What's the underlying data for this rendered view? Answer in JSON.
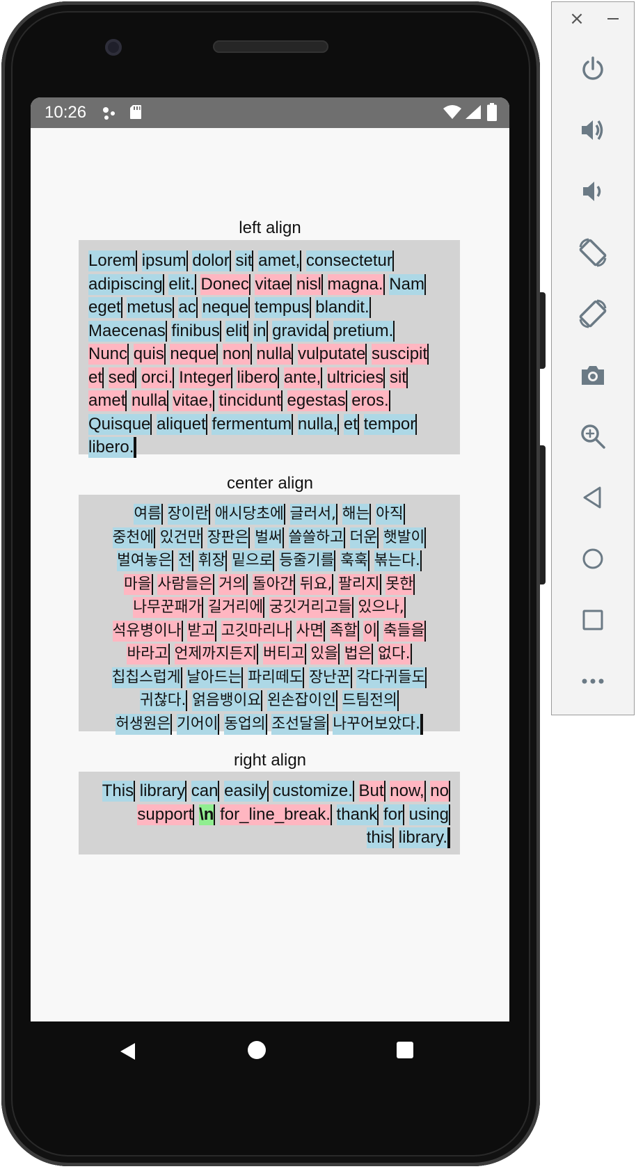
{
  "statusbar": {
    "time": "10:26",
    "icons": [
      "notification-dots-icon",
      "sd-card-icon",
      "wifi-icon",
      "cell-signal-icon",
      "battery-icon"
    ]
  },
  "colors": {
    "box_bg": "#d3d3d3",
    "blue": "#add8e6",
    "pink": "#ffb6c1",
    "green": "#90ee90",
    "status_bar": "#6f6f6f"
  },
  "sections": {
    "left": {
      "title": "left align",
      "lines": [
        [
          [
            "Lorem",
            "b"
          ],
          [
            "ipsum",
            "b"
          ],
          [
            "dolor",
            "b"
          ],
          [
            "sit",
            "b"
          ],
          [
            "amet,",
            "b"
          ],
          [
            "consectetur",
            "b"
          ]
        ],
        [
          [
            "adipiscing",
            "b"
          ],
          [
            "elit.",
            "b"
          ],
          [
            "Donec",
            "p"
          ],
          [
            "vitae",
            "p"
          ],
          [
            "nisl",
            "p"
          ],
          [
            "magna.",
            "p"
          ],
          [
            "Nam",
            "b"
          ]
        ],
        [
          [
            "eget",
            "b"
          ],
          [
            "metus",
            "b"
          ],
          [
            "ac",
            "b"
          ],
          [
            "neque",
            "b"
          ],
          [
            "tempus",
            "b"
          ],
          [
            "blandit.",
            "b"
          ]
        ],
        [
          [
            "Maecenas",
            "b"
          ],
          [
            "finibus",
            "b"
          ],
          [
            "elit",
            "b"
          ],
          [
            "in",
            "b"
          ],
          [
            "gravida",
            "b"
          ],
          [
            "pretium.",
            "b"
          ]
        ],
        [
          [
            "Nunc",
            "p"
          ],
          [
            "quis",
            "p"
          ],
          [
            "neque",
            "p"
          ],
          [
            "non",
            "p"
          ],
          [
            "nulla",
            "p"
          ],
          [
            "vulputate",
            "p"
          ],
          [
            "suscipit",
            "p"
          ]
        ],
        [
          [
            "et",
            "p"
          ],
          [
            "sed",
            "p"
          ],
          [
            "orci.",
            "p"
          ],
          [
            "Integer",
            "p"
          ],
          [
            "libero",
            "p"
          ],
          [
            "ante,",
            "p"
          ],
          [
            "ultricies",
            "p"
          ],
          [
            "sit",
            "p"
          ]
        ],
        [
          [
            "amet",
            "p"
          ],
          [
            "nulla",
            "p"
          ],
          [
            "vitae,",
            "p"
          ],
          [
            "tincidunt",
            "p"
          ],
          [
            "egestas",
            "p"
          ],
          [
            "eros.",
            "p"
          ]
        ],
        [
          [
            "Quisque",
            "b"
          ],
          [
            "aliquet",
            "b"
          ],
          [
            "fermentum",
            "b"
          ],
          [
            "nulla,",
            "b"
          ],
          [
            "et",
            "b"
          ],
          [
            "tempor",
            "b"
          ]
        ],
        [
          [
            "libero.",
            "b"
          ]
        ]
      ]
    },
    "center": {
      "title": "center align",
      "lines": [
        [
          [
            "여름",
            "b"
          ],
          [
            "장이란",
            "b"
          ],
          [
            "애시당초에",
            "b"
          ],
          [
            "글러서,",
            "b"
          ],
          [
            "해는",
            "b"
          ],
          [
            "아직",
            "b"
          ]
        ],
        [
          [
            "중천에",
            "b"
          ],
          [
            "있건만",
            "b"
          ],
          [
            "장판은",
            "b"
          ],
          [
            "벌써",
            "b"
          ],
          [
            "쓸쓸하고",
            "b"
          ],
          [
            "더운",
            "b"
          ],
          [
            "햇발이",
            "b"
          ]
        ],
        [
          [
            "벌여놓은",
            "b"
          ],
          [
            "전",
            "b"
          ],
          [
            "휘장",
            "b"
          ],
          [
            "밑으로",
            "b"
          ],
          [
            "등줄기를",
            "b"
          ],
          [
            "훅훅",
            "b"
          ],
          [
            "볶는다.",
            "b"
          ]
        ],
        [
          [
            "마을",
            "p"
          ],
          [
            "사람들은",
            "p"
          ],
          [
            "거의",
            "p"
          ],
          [
            "돌아간",
            "p"
          ],
          [
            "뒤요,",
            "p"
          ],
          [
            "팔리지",
            "p"
          ],
          [
            "못한",
            "p"
          ]
        ],
        [
          [
            "나무꾼패가",
            "p"
          ],
          [
            "길거리에",
            "p"
          ],
          [
            "궁깃거리고들",
            "p"
          ],
          [
            "있으나,",
            "p"
          ]
        ],
        [
          [
            "석유병이나",
            "p"
          ],
          [
            "받고",
            "p"
          ],
          [
            "고깃마리나",
            "p"
          ],
          [
            "사면",
            "p"
          ],
          [
            "족할",
            "p"
          ],
          [
            "이",
            "p"
          ],
          [
            "축들을",
            "p"
          ]
        ],
        [
          [
            "바라고",
            "p"
          ],
          [
            "언제까지든지",
            "p"
          ],
          [
            "버티고",
            "p"
          ],
          [
            "있을",
            "p"
          ],
          [
            "법은",
            "p"
          ],
          [
            "없다.",
            "p"
          ]
        ],
        [
          [
            "칩칩스럽게",
            "b"
          ],
          [
            "날아드는",
            "b"
          ],
          [
            "파리떼도",
            "b"
          ],
          [
            "장난꾼",
            "b"
          ],
          [
            "각다귀들도",
            "b"
          ]
        ],
        [
          [
            "귀찮다.",
            "b"
          ],
          [
            "얽음뱅이요",
            "b"
          ],
          [
            "왼손잡이인",
            "b"
          ],
          [
            "드팀전의",
            "b"
          ]
        ],
        [
          [
            "허생원은",
            "b"
          ],
          [
            "기어이",
            "b"
          ],
          [
            "동업의",
            "b"
          ],
          [
            "조선달을",
            "b"
          ],
          [
            "나꾸어보았다.",
            "b"
          ]
        ]
      ]
    },
    "right": {
      "title": "right align",
      "lines": [
        [
          [
            "This",
            "b"
          ],
          [
            "library",
            "b"
          ],
          [
            "can",
            "b"
          ],
          [
            "easily",
            "b"
          ],
          [
            "customize.",
            "b"
          ],
          [
            "But",
            "p"
          ],
          [
            "now,",
            "p"
          ],
          [
            "no",
            "p"
          ]
        ],
        [
          [
            "support",
            "p"
          ],
          [
            "\\n",
            "g"
          ],
          [
            "for_line_break.",
            "p"
          ],
          [
            "thank",
            "b"
          ],
          [
            "for",
            "b"
          ],
          [
            "using",
            "b"
          ]
        ],
        [
          [
            "this",
            "b"
          ],
          [
            "library.",
            "b"
          ]
        ]
      ]
    }
  },
  "toolbar": {
    "close_label": "×",
    "buttons": [
      "power-icon",
      "volume-up-icon",
      "volume-down-icon",
      "rotate-left-icon",
      "rotate-right-icon",
      "camera-icon",
      "zoom-icon",
      "back-icon",
      "home-icon",
      "overview-icon",
      "more-icon"
    ]
  }
}
